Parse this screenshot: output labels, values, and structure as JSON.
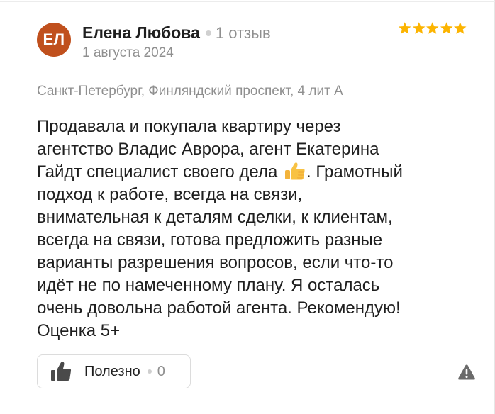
{
  "author": {
    "initials": "ЕЛ",
    "name": "Елена Любова",
    "review_count": "1 отзыв",
    "date": "1 августа 2024",
    "avatar_color": "#c0501d"
  },
  "rating": {
    "value": 5,
    "max": 5,
    "star_color": "#fcb400"
  },
  "address": "Санкт-Петербург, Финляндский проспект, 4 лит А",
  "review": {
    "lines": [
      "Продавала и покупала квартиру через",
      "агентство Владис Аврора, агент Екатерина",
      "Гайдт специалист своего дела ",
      ". Грамотный",
      "подход к работе, всегда на связи,",
      "внимательная к деталям сделки, к клиентам,",
      "всегда на связи, готова предложить разные",
      "варианты разрешения вопросов, если что-то",
      "идёт не по намеченному плану. Я осталась",
      "очень довольна работой агента. Рекомендую!",
      "Оценка 5+"
    ],
    "emoji": "thumbs-up"
  },
  "useful": {
    "label": "Полезно",
    "count": "0",
    "icon": "thumbs-up-icon"
  },
  "report": {
    "icon": "warning-icon"
  }
}
